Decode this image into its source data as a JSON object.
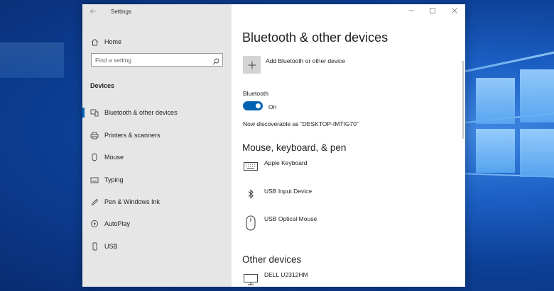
{
  "window": {
    "title": "Settings",
    "controls": [
      "minimize",
      "maximize",
      "close"
    ]
  },
  "sidebar": {
    "home_label": "Home",
    "search_placeholder": "Find a setting",
    "section_title": "Devices",
    "items": [
      {
        "label": "Bluetooth & other devices",
        "icon": "bluetooth-devices-icon",
        "active": true
      },
      {
        "label": "Printers & scanners",
        "icon": "printer-icon"
      },
      {
        "label": "Mouse",
        "icon": "mouse-icon"
      },
      {
        "label": "Typing",
        "icon": "keyboard-icon"
      },
      {
        "label": "Pen & Windows Ink",
        "icon": "pen-icon"
      },
      {
        "label": "AutoPlay",
        "icon": "autoplay-icon"
      },
      {
        "label": "USB",
        "icon": "usb-icon"
      }
    ]
  },
  "content": {
    "page_title": "Bluetooth & other devices",
    "add_device_label": "Add Bluetooth or other device",
    "bluetooth_label": "Bluetooth",
    "bluetooth_state": "On",
    "discoverable_text": "Now discoverable as “DESKTOP-IMTIG70”",
    "mkp_section": "Mouse, keyboard, & pen",
    "devices": [
      {
        "name": "Apple Keyboard",
        "icon": "keyboard-icon"
      },
      {
        "name": "USB Input Device",
        "icon": "bluetooth-icon"
      },
      {
        "name": "USB Optical Mouse",
        "icon": "mouse-icon"
      }
    ],
    "other_section": "Other devices",
    "other_devices": [
      {
        "name": "DELL U2312HM",
        "icon": "monitor-icon"
      }
    ]
  },
  "colors": {
    "accent": "#0063b1",
    "sidebar_bg": "#e6e6e6"
  }
}
